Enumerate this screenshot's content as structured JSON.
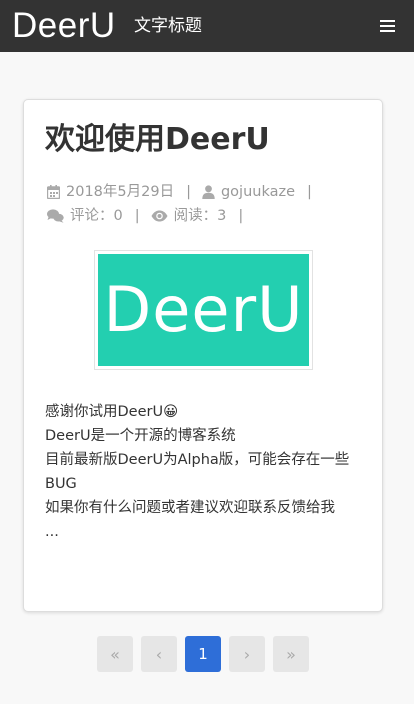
{
  "navbar": {
    "brand": "DeerU",
    "title": "文字标题"
  },
  "post": {
    "title": "欢迎使用DeerU",
    "date": "2018年5月29日",
    "author": "gojuukaze",
    "comments_label": "评论：0",
    "views_label": "阅读：3",
    "separator": "|",
    "logo_text": "DeerU",
    "excerpt": [
      "感谢你试用DeerU😀",
      "DeerU是一个开源的博客系统",
      "目前最新版DeerU为Alpha版，可能会存在一些BUG",
      "如果你有什么问题或者建议欢迎联系反馈给我",
      "..."
    ]
  },
  "pagination": {
    "first": "«",
    "prev": "‹",
    "current": "1",
    "next": "›",
    "last": "»"
  },
  "colors": {
    "navbar_bg": "#333333",
    "logo_bg": "#23cfb0",
    "active_page": "#2e6ed8"
  },
  "icons": {
    "menu": "menu-icon",
    "calendar": "calendar-icon",
    "user": "user-icon",
    "comments": "comments-icon",
    "eye": "eye-icon"
  }
}
